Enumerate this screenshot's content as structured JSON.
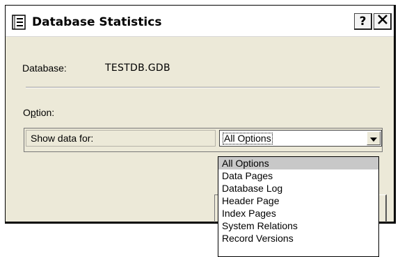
{
  "window": {
    "title": "Database Statistics",
    "icon": "database-stats-icon",
    "help_label": "?",
    "close_icon": "close-icon"
  },
  "database": {
    "label": "Database:",
    "value": "TESTDB.GDB"
  },
  "option": {
    "label_accel": "p",
    "label_prefix": "O",
    "label_suffix": "tion:"
  },
  "grid": {
    "row_label": "Show data for:",
    "selected_value": "All Options"
  },
  "dropdown": {
    "options": [
      "All Options",
      "Data Pages",
      "Database Log",
      "Header Page",
      "Index Pages",
      "System Relations",
      "Record Versions"
    ],
    "highlighted": "All Options"
  }
}
